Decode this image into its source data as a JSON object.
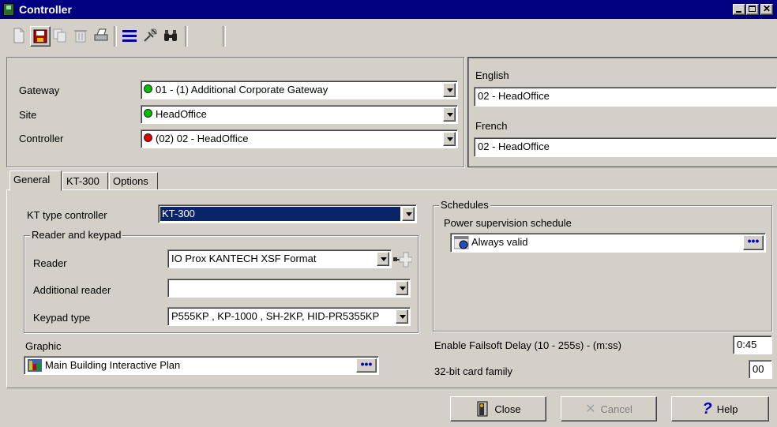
{
  "window": {
    "title": "Controller"
  },
  "toolbar": {
    "buttons": [
      "new-icon",
      "save-icon",
      "copy-icon",
      "delete-icon",
      "print-icon",
      "list-icon",
      "link-icon",
      "find-icon"
    ]
  },
  "header": {
    "gateway": {
      "label": "Gateway",
      "value": "01 - (1)  Additional Corporate Gateway",
      "status_color": "#00c000"
    },
    "site": {
      "label": "Site",
      "value": "HeadOffice",
      "status_color": "#00c000"
    },
    "controller": {
      "label": "Controller",
      "value": "(02) 02 - HeadOffice",
      "status_color": "#e00000"
    },
    "english": {
      "label": "English",
      "value": "02 - HeadOffice"
    },
    "french": {
      "label": "French",
      "value": "02 - HeadOffice"
    }
  },
  "tabs": [
    {
      "label": "General",
      "active": true
    },
    {
      "label": "KT-300",
      "active": false
    },
    {
      "label": "Options",
      "active": false
    }
  ],
  "general": {
    "kt_type_label": "KT type controller",
    "kt_type_value": "KT-300",
    "reader_group": {
      "legend": "Reader and keypad",
      "reader_label": "Reader",
      "reader_value": "IO Prox KANTECH XSF Format",
      "additional_reader_label": "Additional reader",
      "additional_reader_value": "",
      "keypad_label": "Keypad type",
      "keypad_value": "P555KP , KP-1000 , SH-2KP, HID-PR5355KP"
    },
    "graphic": {
      "label": "Graphic",
      "value": "Main Building  Interactive Plan"
    },
    "schedules": {
      "legend": "Schedules",
      "power_label": "Power supervision schedule",
      "power_value": "Always valid"
    },
    "failsoft": {
      "label": "Enable Failsoft Delay (10 - 255s) - (m:ss)",
      "value": "0:45"
    },
    "card_family": {
      "label": "32-bit card family",
      "value": "00"
    }
  },
  "footer": {
    "close_label": "Close",
    "cancel_label": "Cancel",
    "help_label": "Help"
  }
}
